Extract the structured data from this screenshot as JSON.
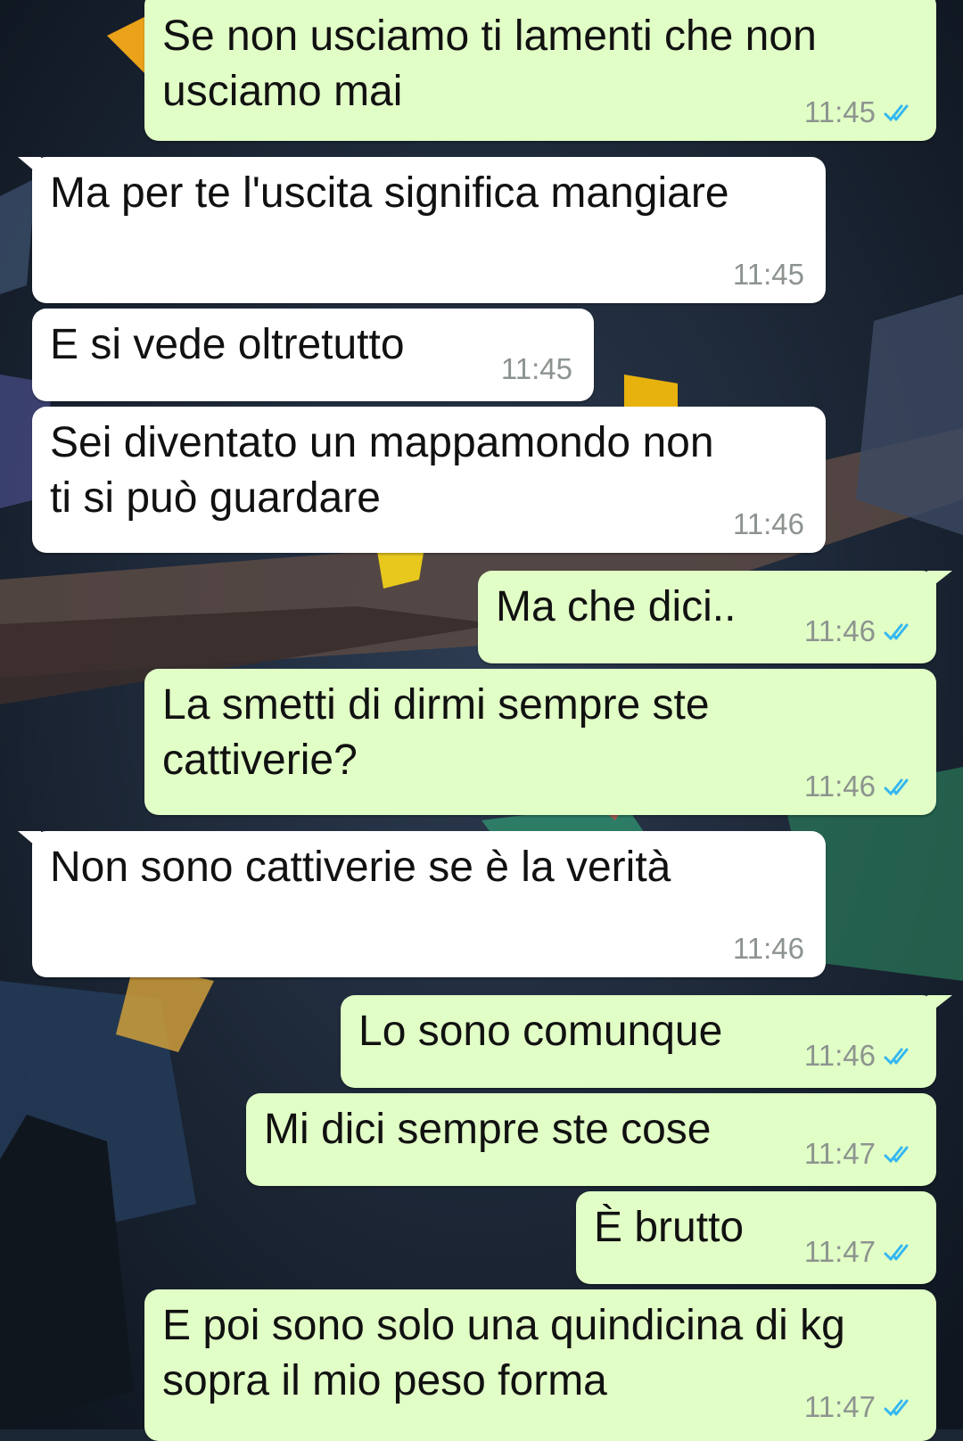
{
  "colors": {
    "incoming_bubble": "#ffffff",
    "outgoing_bubble": "#e1fec6",
    "timestamp": "#8d948f",
    "read_ticks": "#34b7f1"
  },
  "messages": [
    {
      "direction": "out",
      "text": "Se non usciamo ti lamenti che non\nusciamo mai",
      "time": "11:45",
      "status": "read-double-tick-icon"
    },
    {
      "direction": "in",
      "text": "Ma per te l'uscita significa mangiare",
      "time": "11:45"
    },
    {
      "direction": "in",
      "text": "E si vede oltretutto",
      "time": "11:45"
    },
    {
      "direction": "in",
      "text": "Sei diventato un mappamondo non\nti si può guardare",
      "time": "11:46"
    },
    {
      "direction": "out",
      "text": "Ma che dici..",
      "time": "11:46",
      "status": "read-double-tick-icon"
    },
    {
      "direction": "out",
      "text": "La smetti di dirmi sempre ste\ncattiverie?",
      "time": "11:46",
      "status": "read-double-tick-icon"
    },
    {
      "direction": "in",
      "text": "Non sono cattiverie se è la verità",
      "time": "11:46"
    },
    {
      "direction": "out",
      "text": "Lo sono comunque",
      "time": "11:46",
      "status": "read-double-tick-icon"
    },
    {
      "direction": "out",
      "text": "Mi dici sempre ste cose",
      "time": "11:47",
      "status": "read-double-tick-icon"
    },
    {
      "direction": "out",
      "text": "È brutto",
      "time": "11:47",
      "status": "read-double-tick-icon"
    },
    {
      "direction": "out",
      "text": "E poi sono solo una quindicina di kg\nsopra il mio peso forma",
      "time": "11:47",
      "status": "read-double-tick-icon"
    }
  ]
}
